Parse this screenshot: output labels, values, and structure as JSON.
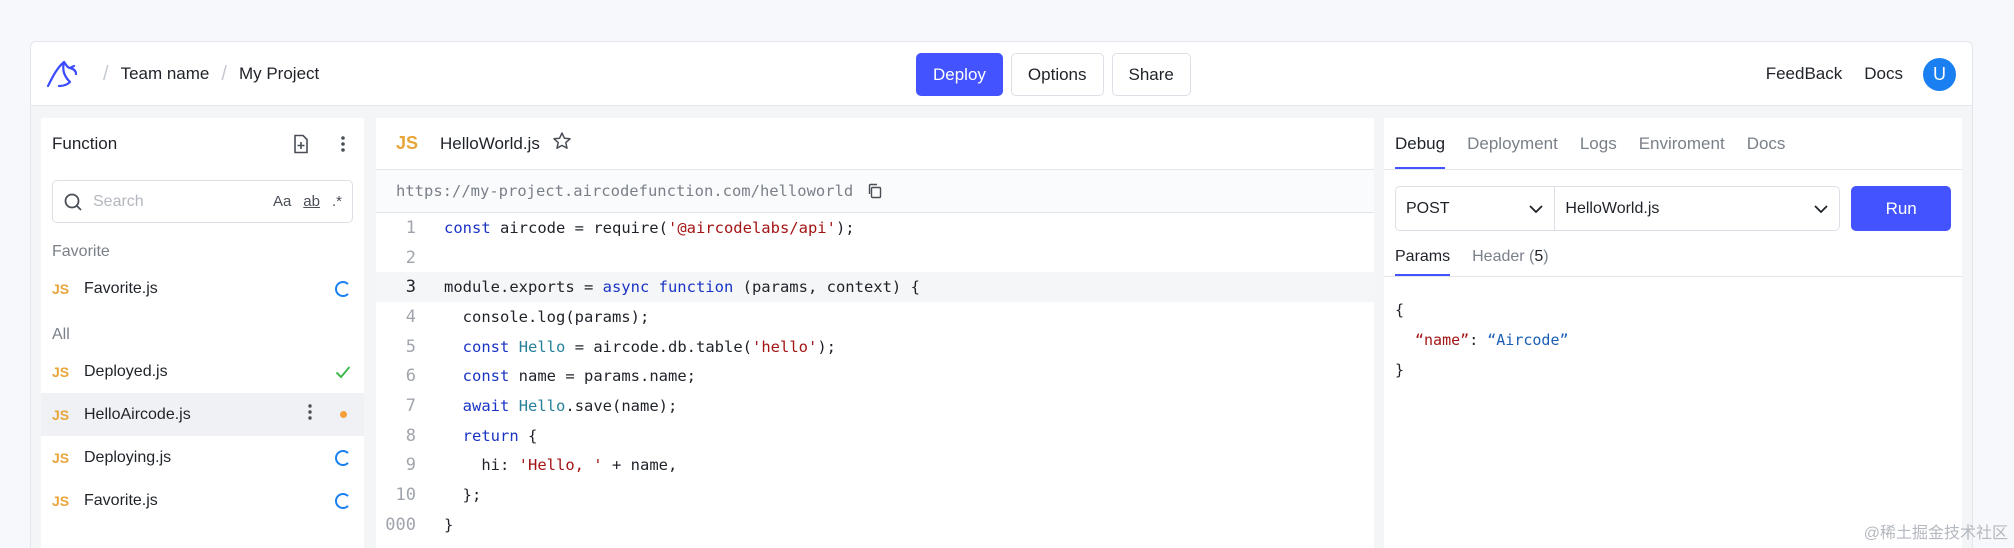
{
  "header": {
    "breadcrumb": [
      "Team name",
      "My Project"
    ],
    "buttons": {
      "deploy": "Deploy",
      "options": "Options",
      "share": "Share"
    },
    "links": {
      "feedback": "FeedBack",
      "docs": "Docs"
    },
    "avatar_initial": "U"
  },
  "sidebar": {
    "title": "Function",
    "search_placeholder": "Search",
    "search_options": [
      "Aa",
      "ab",
      ".*"
    ],
    "sections": [
      {
        "label": "Favorite",
        "items": [
          {
            "icon": "JS",
            "name": "Favorite.js",
            "status": "loading"
          }
        ]
      },
      {
        "label": "All",
        "items": [
          {
            "icon": "JS",
            "name": "Deployed.js",
            "status": "deployed"
          },
          {
            "icon": "JS",
            "name": "HelloAircode.js",
            "status": "modified"
          },
          {
            "icon": "JS",
            "name": "Deploying.js",
            "status": "loading"
          },
          {
            "icon": "JS",
            "name": "Favorite.js",
            "status": "loading"
          }
        ]
      }
    ]
  },
  "editor": {
    "tab_icon": "JS",
    "tab_name": "HelloWorld.js",
    "url": "https://my-project.aircodefunction.com/helloworld",
    "line_numbers": [
      "1",
      "2",
      "3",
      "4",
      "5",
      "6",
      "7",
      "8",
      "9",
      "10",
      "000"
    ],
    "current_line": 3
  },
  "panel": {
    "tabs": [
      "Debug",
      "Deployment",
      "Logs",
      "Enviroment",
      "Docs"
    ],
    "method": "POST",
    "file": "HelloWorld.js",
    "run_label": "Run",
    "subtabs": {
      "params": "Params",
      "header": "Header (",
      "header_count": "5",
      "header_close": ")"
    },
    "json_open": "{",
    "json_key": "“name”",
    "json_colon": ": ",
    "json_value": "“Aircode”",
    "json_close": "}"
  },
  "watermark": "@稀土掘金技术社区",
  "colors": {
    "accent": "#4353ff",
    "js": "#e8a53a",
    "loading": "#1a7ff0",
    "success": "#3fb950",
    "modified": "#f5a03a"
  }
}
